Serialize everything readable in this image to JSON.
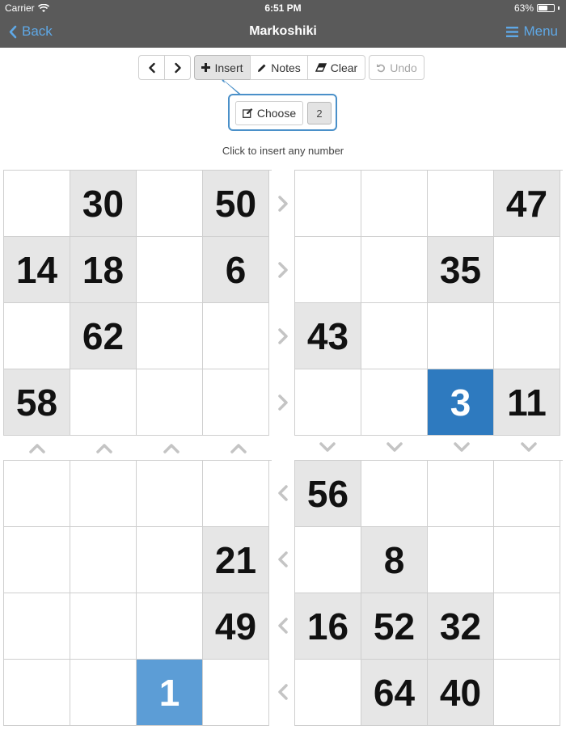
{
  "status": {
    "carrier": "Carrier",
    "time": "6:51 PM",
    "battery": "63%",
    "battery_level": 0.63
  },
  "nav": {
    "back_label": "Back",
    "title": "Markoshiki",
    "menu_label": "Menu"
  },
  "toolbar": {
    "insert_label": "Insert",
    "notes_label": "Notes",
    "clear_label": "Clear",
    "undo_label": "Undo"
  },
  "popover": {
    "choose_label": "Choose",
    "number": "2"
  },
  "hint": "Click to insert any number",
  "blocks": [
    {
      "cells": [
        {
          "v": "",
          "s": "n"
        },
        {
          "v": "30",
          "s": "g"
        },
        {
          "v": "",
          "s": "n"
        },
        {
          "v": "50",
          "s": "g"
        },
        {
          "v": "14",
          "s": "g"
        },
        {
          "v": "18",
          "s": "g"
        },
        {
          "v": "",
          "s": "n"
        },
        {
          "v": "6",
          "s": "g"
        },
        {
          "v": "",
          "s": "n"
        },
        {
          "v": "62",
          "s": "g"
        },
        {
          "v": "",
          "s": "n"
        },
        {
          "v": "",
          "s": "n"
        },
        {
          "v": "58",
          "s": "g"
        },
        {
          "v": "",
          "s": "n"
        },
        {
          "v": "",
          "s": "n"
        },
        {
          "v": "",
          "s": "n"
        }
      ]
    },
    {
      "cells": [
        {
          "v": "",
          "s": "n"
        },
        {
          "v": "",
          "s": "n"
        },
        {
          "v": "",
          "s": "n"
        },
        {
          "v": "47",
          "s": "g"
        },
        {
          "v": "",
          "s": "n"
        },
        {
          "v": "",
          "s": "n"
        },
        {
          "v": "35",
          "s": "g"
        },
        {
          "v": "",
          "s": "n"
        },
        {
          "v": "43",
          "s": "g"
        },
        {
          "v": "",
          "s": "n"
        },
        {
          "v": "",
          "s": "n"
        },
        {
          "v": "",
          "s": "n"
        },
        {
          "v": "",
          "s": "n"
        },
        {
          "v": "",
          "s": "n"
        },
        {
          "v": "3",
          "s": "sel"
        },
        {
          "v": "11",
          "s": "g"
        }
      ]
    },
    {
      "cells": [
        {
          "v": "",
          "s": "n"
        },
        {
          "v": "",
          "s": "n"
        },
        {
          "v": "",
          "s": "n"
        },
        {
          "v": "",
          "s": "n"
        },
        {
          "v": "",
          "s": "n"
        },
        {
          "v": "",
          "s": "n"
        },
        {
          "v": "",
          "s": "n"
        },
        {
          "v": "21",
          "s": "g"
        },
        {
          "v": "",
          "s": "n"
        },
        {
          "v": "",
          "s": "n"
        },
        {
          "v": "",
          "s": "n"
        },
        {
          "v": "49",
          "s": "g"
        },
        {
          "v": "",
          "s": "n"
        },
        {
          "v": "",
          "s": "n"
        },
        {
          "v": "1",
          "s": "hl"
        },
        {
          "v": "",
          "s": "n"
        }
      ]
    },
    {
      "cells": [
        {
          "v": "56",
          "s": "g"
        },
        {
          "v": "",
          "s": "n"
        },
        {
          "v": "",
          "s": "n"
        },
        {
          "v": "",
          "s": "n"
        },
        {
          "v": "",
          "s": "n"
        },
        {
          "v": "8",
          "s": "g"
        },
        {
          "v": "",
          "s": "n"
        },
        {
          "v": "",
          "s": "n"
        },
        {
          "v": "16",
          "s": "g"
        },
        {
          "v": "52",
          "s": "g"
        },
        {
          "v": "32",
          "s": "g"
        },
        {
          "v": "",
          "s": "n"
        },
        {
          "v": "",
          "s": "n"
        },
        {
          "v": "64",
          "s": "g"
        },
        {
          "v": "40",
          "s": "g"
        },
        {
          "v": "",
          "s": "n"
        }
      ]
    }
  ],
  "arrows": {
    "right_column": [
      "right",
      "right",
      "right",
      "right"
    ],
    "left_column": [
      "left",
      "left",
      "left",
      "left"
    ],
    "top_left_row": [
      "up",
      "up",
      "up",
      "up"
    ],
    "top_right_row": [
      "down",
      "down",
      "down",
      "down"
    ]
  },
  "colors": {
    "selected": "#2e7abf",
    "highlight": "#5c9dd6",
    "given": "#e6e6e6",
    "accent": "#5fa8e6",
    "arrow": "#c4c4c4"
  }
}
